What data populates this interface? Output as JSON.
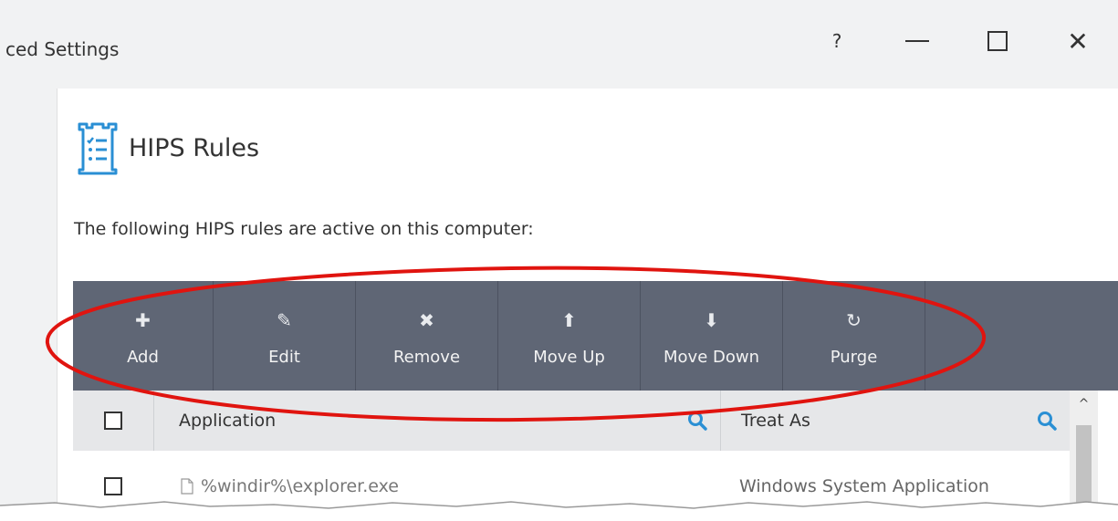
{
  "window": {
    "title": "ced Settings",
    "controls": {
      "help": "?",
      "minimize": "minimize",
      "maximize": "maximize",
      "close": "✕"
    }
  },
  "panel": {
    "title": "HIPS Rules",
    "description": "The following HIPS rules are active on this computer:"
  },
  "toolbar": {
    "buttons": [
      {
        "label": "Add",
        "icon": "plus-icon",
        "glyph": "✚"
      },
      {
        "label": "Edit",
        "icon": "edit-pencil-icon",
        "glyph": "✎"
      },
      {
        "label": "Remove",
        "icon": "remove-x-icon",
        "glyph": "✖"
      },
      {
        "label": "Move Up",
        "icon": "arrow-up-icon",
        "glyph": "⬆"
      },
      {
        "label": "Move Down",
        "icon": "arrow-down-icon",
        "glyph": "⬇"
      },
      {
        "label": "Purge",
        "icon": "purge-refresh-icon",
        "glyph": "↻"
      }
    ]
  },
  "grid": {
    "columns": [
      "Application",
      "Treat As"
    ],
    "rows": [
      {
        "application": "%windir%\\explorer.exe",
        "treat_as": "Windows System Application"
      }
    ]
  },
  "colors": {
    "toolbar_bg": "#5f6675",
    "header_bg": "#e6e7e9",
    "window_bg": "#f1f2f3",
    "icon_blue": "#2a8fd4",
    "annotation_red": "#e0140f"
  }
}
